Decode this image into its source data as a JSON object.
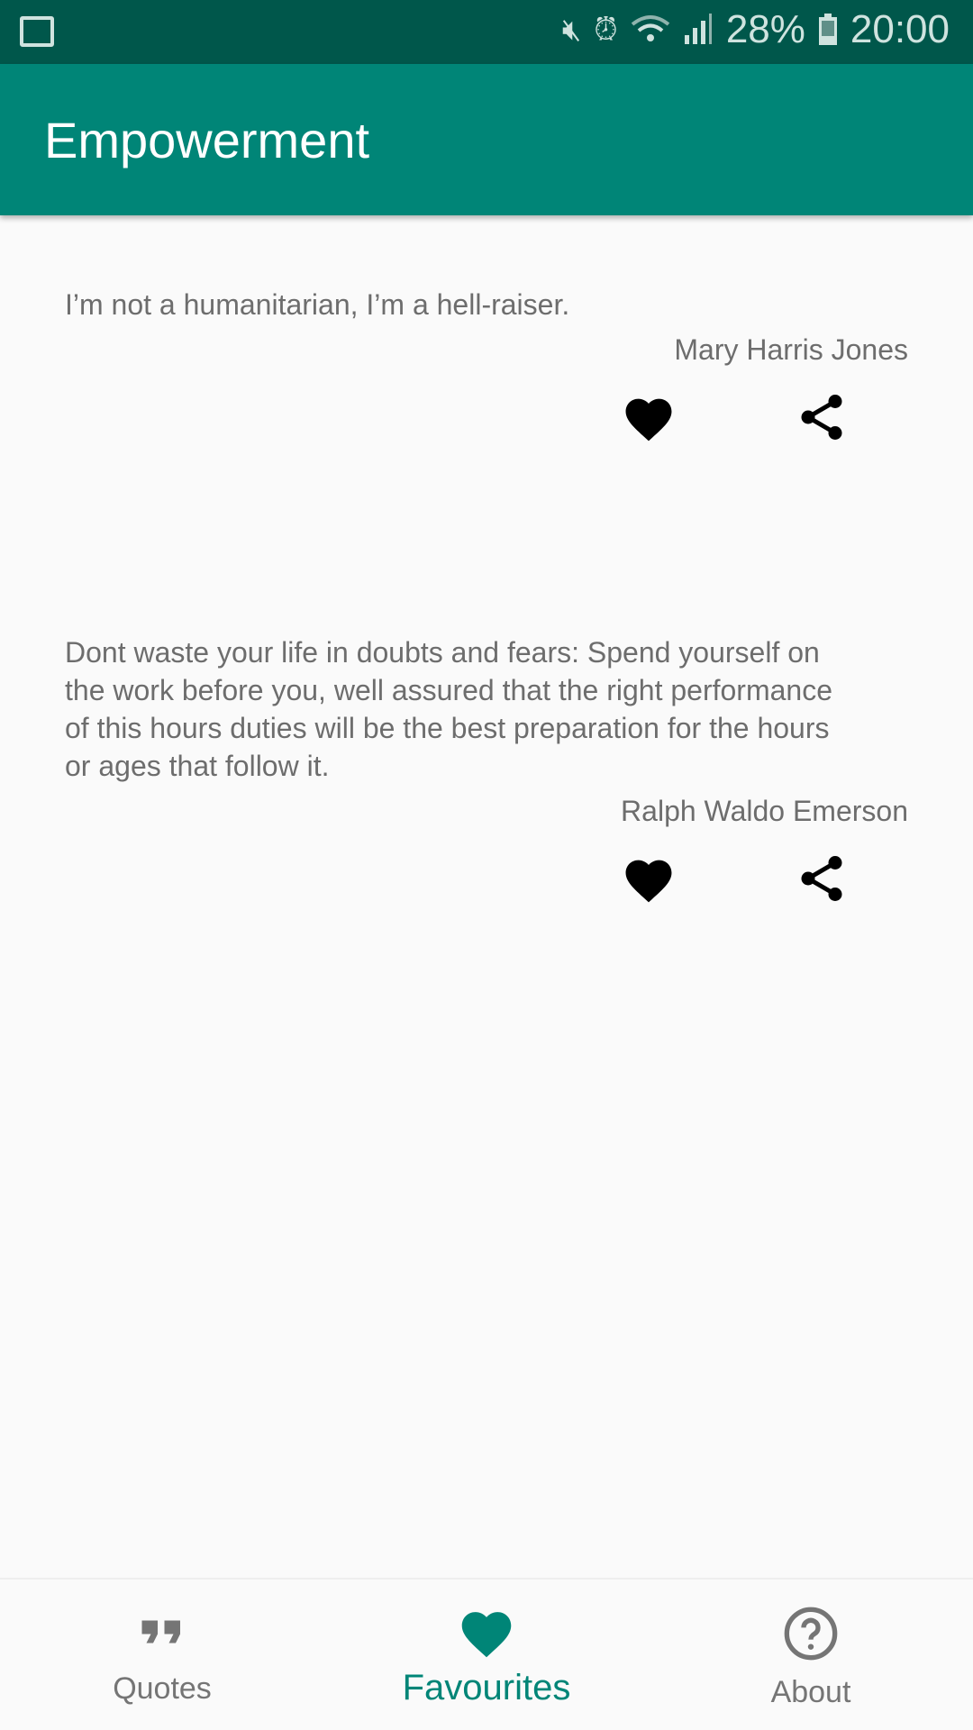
{
  "status_bar": {
    "battery": "28%",
    "time": "20:00",
    "icons": [
      "image-icon",
      "mute-icon",
      "alarm-icon",
      "wifi-icon",
      "signal-icon",
      "battery-icon"
    ]
  },
  "app_bar": {
    "title": "Empowerment"
  },
  "quotes": [
    {
      "text": "I’m not a humanitarian, I’m a hell-raiser.",
      "author": "Mary Harris Jones",
      "favourited": true
    },
    {
      "text": "Dont waste your life in doubts and fears: Spend yourself on the work before you, well assured that the right performance of this hours duties will be the best preparation for the hours or ages that follow it.",
      "author": "Ralph Waldo Emerson",
      "favourited": true
    }
  ],
  "bottom_nav": {
    "items": [
      {
        "label": "Quotes",
        "icon": "quote-icon"
      },
      {
        "label": "Favourites",
        "icon": "heart-icon",
        "active": true
      },
      {
        "label": "About",
        "icon": "help-icon"
      }
    ]
  },
  "colors": {
    "primary": "#008577",
    "primary_dark": "#00574b",
    "accent": "#008577"
  }
}
